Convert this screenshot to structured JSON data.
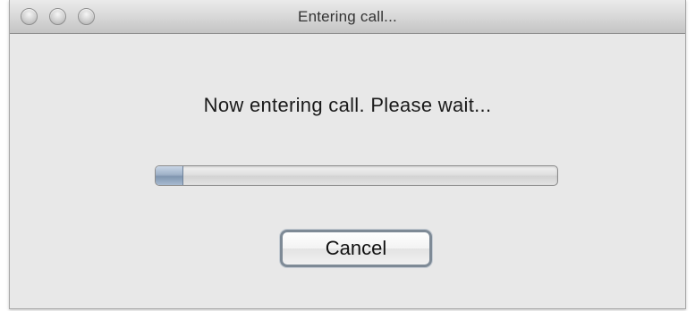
{
  "window": {
    "title": "Entering call..."
  },
  "dialog": {
    "message": "Now entering call. Please wait...",
    "progress_fraction": 0.07,
    "cancel_label": "Cancel"
  },
  "icons": {
    "close": "close-icon",
    "minimize": "minimize-icon",
    "zoom": "zoom-icon"
  }
}
